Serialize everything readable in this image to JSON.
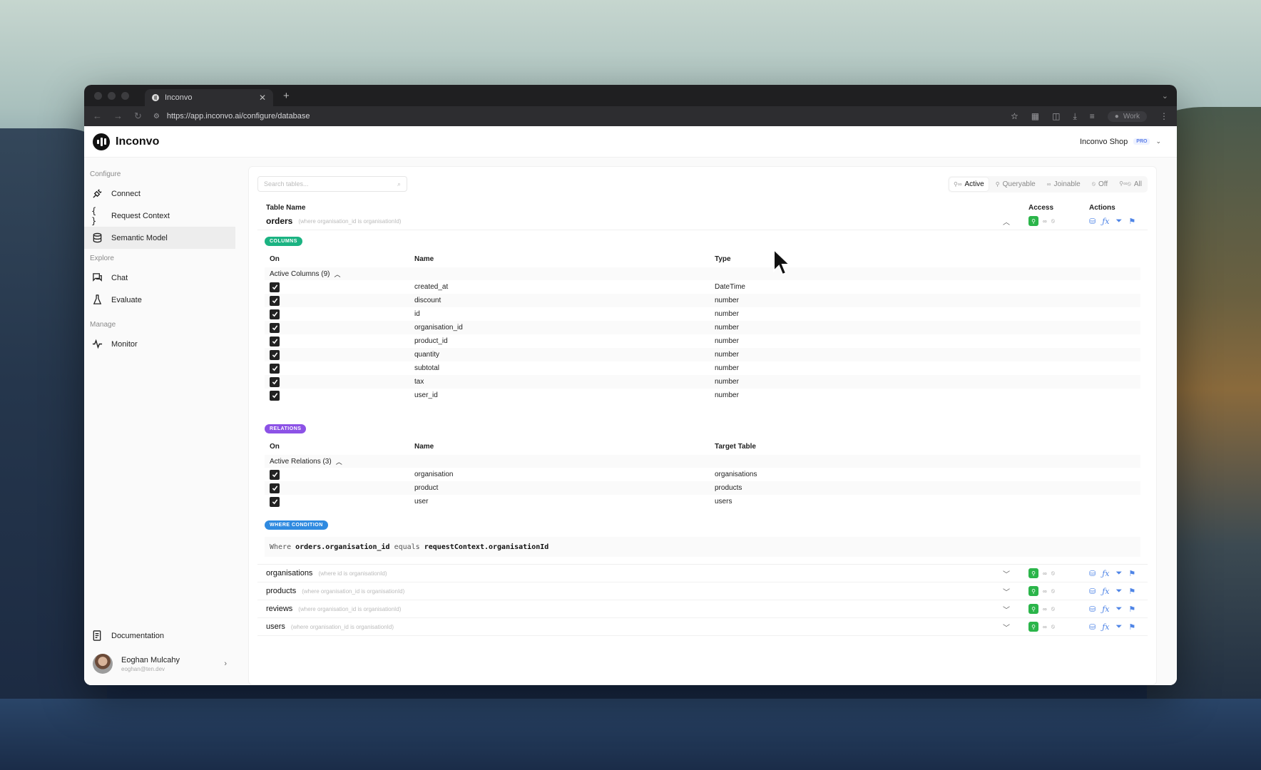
{
  "browser": {
    "tab_title": "Inconvo",
    "url": "https://app.inconvo.ai/configure/database",
    "profile": "Work"
  },
  "app": {
    "name": "Inconvo",
    "org": "Inconvo Shop",
    "plan_badge": "PRO"
  },
  "sidebar": {
    "sections": {
      "configure": "Configure",
      "explore": "Explore",
      "manage": "Manage"
    },
    "items": {
      "connect": "Connect",
      "request_context": "Request Context",
      "semantic_model": "Semantic Model",
      "chat": "Chat",
      "evaluate": "Evaluate",
      "monitor": "Monitor",
      "documentation": "Documentation"
    },
    "user": {
      "name": "Eoghan Mulcahy",
      "email": "eoghan@ten.dev"
    }
  },
  "toolbar": {
    "search_placeholder": "Search tables...",
    "filters": [
      "Active",
      "Queryable",
      "Joinable",
      "Off",
      "All"
    ],
    "active_filter": "Active"
  },
  "table_header": {
    "name": "Table Name",
    "access": "Access",
    "actions": "Actions"
  },
  "tables": [
    {
      "name": "orders",
      "condition": "(where organisation_id is organisationId)"
    },
    {
      "name": "organisations",
      "condition": "(where id is organisationId)"
    },
    {
      "name": "products",
      "condition": "(where organisation_id is organisationId)"
    },
    {
      "name": "reviews",
      "condition": "(where organisation_id is organisationId)"
    },
    {
      "name": "users",
      "condition": "(where organisation_id is organisationId)"
    }
  ],
  "columns_section": {
    "badge": "COLUMNS",
    "head_on": "On",
    "head_name": "Name",
    "head_type": "Type",
    "group_label": "Active Columns (9)",
    "rows": [
      {
        "name": "created_at",
        "type": "DateTime"
      },
      {
        "name": "discount",
        "type": "number"
      },
      {
        "name": "id",
        "type": "number"
      },
      {
        "name": "organisation_id",
        "type": "number"
      },
      {
        "name": "product_id",
        "type": "number"
      },
      {
        "name": "quantity",
        "type": "number"
      },
      {
        "name": "subtotal",
        "type": "number"
      },
      {
        "name": "tax",
        "type": "number"
      },
      {
        "name": "user_id",
        "type": "number"
      }
    ]
  },
  "relations_section": {
    "badge": "RELATIONS",
    "head_on": "On",
    "head_name": "Name",
    "head_target": "Target Table",
    "group_label": "Active Relations (3)",
    "rows": [
      {
        "name": "organisation",
        "target": "organisations"
      },
      {
        "name": "product",
        "target": "products"
      },
      {
        "name": "user",
        "target": "users"
      }
    ]
  },
  "where_section": {
    "badge": "WHERE CONDITION",
    "w1": "Where",
    "field": "orders.organisation_id",
    "op": "equals",
    "value": "requestContext.organisationId"
  },
  "colors": {
    "access_green": "#2bb54a",
    "action_blue": "#4e84e6",
    "columns_badge": "#1bb382",
    "relations_badge": "#8c52e6",
    "where_badge": "#2f8ae0"
  }
}
